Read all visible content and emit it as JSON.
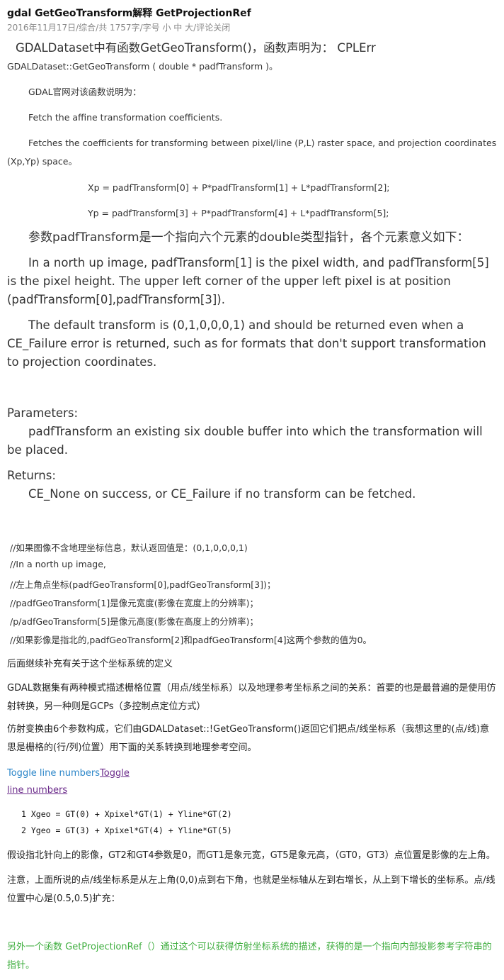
{
  "header": {
    "title": "gdal GetGeoTransform解释 GetProjectionRef",
    "date": "2016年11月17日",
    "category": "综合",
    "count": "共 1757字",
    "font_size_label": "字号",
    "size_small": "小",
    "size_mid": "中",
    "size_large": "大",
    "comments": "评论关闭"
  },
  "intro": {
    "line1": "GDALDataset中有函数GetGeoTransform()，函数声明为： CPLErr",
    "line2": "GDALDataset::GetGeoTransform  ( double *  padfTransform  )。"
  },
  "official": {
    "p1": "GDAL官网对该函数说明为：",
    "p2": "Fetch the affine transformation coefficients.",
    "p3a": "Fetches the coefficients for transforming between pixel/line (P,L) raster space, and projection coordinates",
    "p3b": "(Xp,Yp) space。",
    "f1": "Xp = padfTransform[0] + P*padfTransform[1] + L*padfTransform[2];",
    "f2": "Yp = padfTransform[3] + P*padfTransform[4] + L*padfTransform[5];"
  },
  "param_intro": "参数padfTransform是一个指向六个元素的double类型指针，各个元素意义如下：",
  "english": {
    "p1": "In a north up image, padfTransform[1] is the pixel width, and padfTransform[5] is the pixel height. The upper left corner of the upper left pixel is at position (padfTransform[0],padfTransform[3]).",
    "p2": "The default transform is (0,1,0,0,0,1) and should be returned even when a CE_Failure error is returned, such as for formats that don't support transformation to projection coordinates."
  },
  "params": {
    "heading": "Parameters:",
    "body": "padfTransform  an existing six double buffer into which the transformation will be placed."
  },
  "returns": {
    "heading": "Returns:",
    "body": "CE_None on success, or CE_Failure if no transform can be fetched."
  },
  "comments": [
    "//如果图像不含地理坐标信息，默认返回值是：(0,1,0,0,0,1)",
    "//In a north up image,",
    "//左上角点坐标(padfGeoTransform[0],padfGeoTransform[3])；",
    "//padfGeoTransform[1]是像元宽度(影像在宽度上的分辨率)；",
    "/p/adfGeoTransform[5]是像元高度(影像在高度上的分辨率)；",
    "//如果影像是指北的,padfGeoTransform[2]和padfGeoTransform[4]这两个参数的值为0。"
  ],
  "followup": "后面继续补充有关于这个坐标系统的定义",
  "gdal_desc": "GDAL数据集有两种模式描述栅格位置（用点/线坐标系）以及地理参考坐标系之间的关系：首要的也是最普遍的是使用仿射转换，另一种则是GCPs（多控制点定位方式）",
  "affine_desc": "仿射变换由6个参数构成，它们由GDALDataset::!GetGeoTransform()返回它们把点/线坐标系（我想这里的(点/线)意思是栅格的(行/列)位置）用下面的关系转换到地理参考空间。",
  "toggle": {
    "blue": "Toggle line numbers",
    "purple1": "Toggle",
    "purple2": "line numbers"
  },
  "code": [
    "1 Xgeo = GT(0) + Xpixel*GT(1) + Yline*GT(2)",
    "2 Ygeo = GT(3) + Xpixel*GT(4) + Yline*GT(5)"
  ],
  "north_desc": "假设指北针向上的影像，GT2和GT4参数是0，而GT1是象元宽，GT5是象元高，（GT0，GT3）点位置是影像的左上角。",
  "note": "注意，上面所说的点/线坐标系是从左上角(0,0)点到右下角，也就是坐标轴从左到右增长，从上到下增长的坐标系。点/线位置中心是(0.5,0.5)扩充：",
  "another": "另外一个函数 GetProjectionRef（）通过这个可以获得仿射坐标系统的描述，获得的是一个指向内部投影参考字符串的指针。"
}
